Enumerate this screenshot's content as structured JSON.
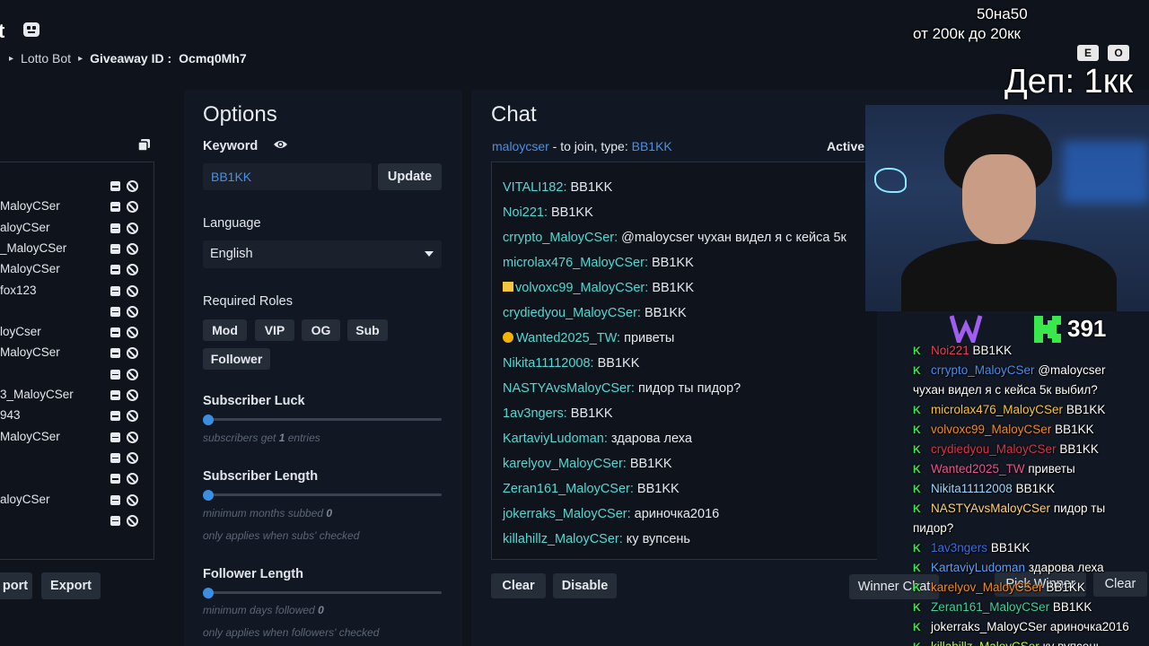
{
  "header": {
    "brand_fragment": "t",
    "breadcrumb": {
      "item1": "Lotto Bot",
      "item2_label": "Giveaway ID :",
      "item2_value": "Ocmq0Mh7"
    }
  },
  "users": {
    "rows": [
      "",
      "MaloyCSer",
      "aloyCSer",
      "_MaloyCSer",
      "MaloyCSer",
      "fox123",
      "",
      "loyCser",
      "MaloyCSer",
      "",
      "3_MaloyCSer",
      "943",
      "MaloyCSer",
      "",
      "",
      "aloyCSer",
      ""
    ],
    "import_label": "port",
    "export_label": "Export"
  },
  "options": {
    "title": "Options",
    "keyword_label": "Keyword",
    "keyword_value": "BB1KK",
    "update_label": "Update",
    "language_label": "Language",
    "language_value": "English",
    "roles_label": "Required Roles",
    "roles": [
      "Mod",
      "VIP",
      "OG",
      "Sub",
      "Follower"
    ],
    "sub_luck_label": "Subscriber Luck",
    "sub_luck_hint_pre": "subscribers get",
    "sub_luck_value": "1",
    "sub_luck_hint_post": "entries",
    "sub_length_label": "Subscriber Length",
    "sub_length_hint_pre": "minimum months subbed",
    "sub_length_value": "0",
    "sub_length_note": "only applies when subs' checked",
    "fol_length_label": "Follower Length",
    "fol_length_hint_pre": "minimum days followed",
    "fol_length_value": "0",
    "fol_length_note": "only applies when followers' checked",
    "slider_levels": {
      "sub_luck": 0,
      "sub_length": 0,
      "fol_length": 0
    }
  },
  "chat": {
    "title": "Chat",
    "channel": "maloycser",
    "join_text": " - to join, type: ",
    "join_keyword": "BB1KK",
    "active_label": "Active",
    "messages": [
      {
        "user": "VITALI182:",
        "text": "BB1KK"
      },
      {
        "user": "Noi221:",
        "text": "BB1KK"
      },
      {
        "user": "crrypto_MaloyCSer:",
        "text": "@maloycser чухан видел я с кейса 5к"
      },
      {
        "user": "microlax476_MaloyCSer:",
        "text": "BB1KK"
      },
      {
        "user": "volvoxc99_MaloyCSer:",
        "text": "BB1KK"
      },
      {
        "user": "crydiedyou_MaloyCSer:",
        "text": "BB1KK"
      },
      {
        "user": "Wanted2025_TW:",
        "text": "приветы"
      },
      {
        "user": "Nikita11112008:",
        "text": "BB1KK"
      },
      {
        "user": "NASTYAvsMaloyCSer:",
        "text": "пидор ты пидор?"
      },
      {
        "user": "1av3ngers:",
        "text": "BB1KK"
      },
      {
        "user": "KartaviyLudoman:",
        "text": "здарова леха"
      },
      {
        "user": "karelyov_MaloyCSer:",
        "text": "BB1KK"
      },
      {
        "user": "Zeran161_MaloyCSer:",
        "text": "BB1KK"
      },
      {
        "user": "jokerraks_MaloyCSer:",
        "text": "ариночка2016"
      },
      {
        "user": "killahillz_MaloyCSer:",
        "text": "ку вупсень"
      }
    ],
    "clear_label": "Clear",
    "disable_label": "Disable",
    "winner_chat_label": "Winner Chat",
    "pick_winner_label": "Pick Winner",
    "clear2_label": "Clear"
  },
  "stream": {
    "line1": "50на50",
    "line2": "от 200к до 20кк",
    "keys": [
      "E",
      "O"
    ],
    "deposit": "Деп: 1кк",
    "kick_count": "391",
    "overlay_chat": [
      {
        "user": "Noi221",
        "text": "BB1KK",
        "color": "#e8415a"
      },
      {
        "user": "crrypto_MaloyCSer",
        "text": "@maloycser",
        "color": "#4a8df0"
      },
      {
        "user": "",
        "text": "чухан видел я с кейса 5к выбил?",
        "color": "#ffffff"
      },
      {
        "user": "microlax476_MaloyCSer",
        "text": "BB1KK",
        "color": "#f5c542"
      },
      {
        "user": "volvoxc99_MaloyCSer",
        "text": "BB1KK",
        "color": "#f08a24"
      },
      {
        "user": "crydiedyou_MaloyCSer",
        "text": "BB1KK",
        "color": "#d9364a"
      },
      {
        "user": "Wanted2025_TW",
        "text": "приветы",
        "color": "#e8578f"
      },
      {
        "user": "Nikita11112008",
        "text": "BB1KK",
        "color": "#9fd8ff"
      },
      {
        "user": "NASTYAvsMaloyCSer",
        "text": "пидор ты",
        "color": "#ffd27a"
      },
      {
        "user": "",
        "text": "пидор?",
        "color": "#ffffff"
      },
      {
        "user": "1av3ngers",
        "text": "BB1KK",
        "color": "#3b6fe0"
      },
      {
        "user": "KartaviyLudoman",
        "text": "здарова леха",
        "color": "#5aa0ff"
      },
      {
        "user": "karelyov_MaloyCSer",
        "text": "BB1KK",
        "color": "#f08a24"
      },
      {
        "user": "Zeran161_MaloyCSer",
        "text": "BB1KK",
        "color": "#39d6a0"
      },
      {
        "user": "jokerraks_MaloyCSer",
        "text": "ариночка2016",
        "color": "#ffffff"
      },
      {
        "user": "killahillz_MaloyCSer",
        "text": "ку вупсень",
        "color": "#b7f542"
      }
    ]
  },
  "colors": {
    "accent": "#3a8fe0",
    "username": "#56d6d0",
    "kick_green": "#39e84a",
    "panel": "#121823",
    "background": "#0f141c"
  }
}
